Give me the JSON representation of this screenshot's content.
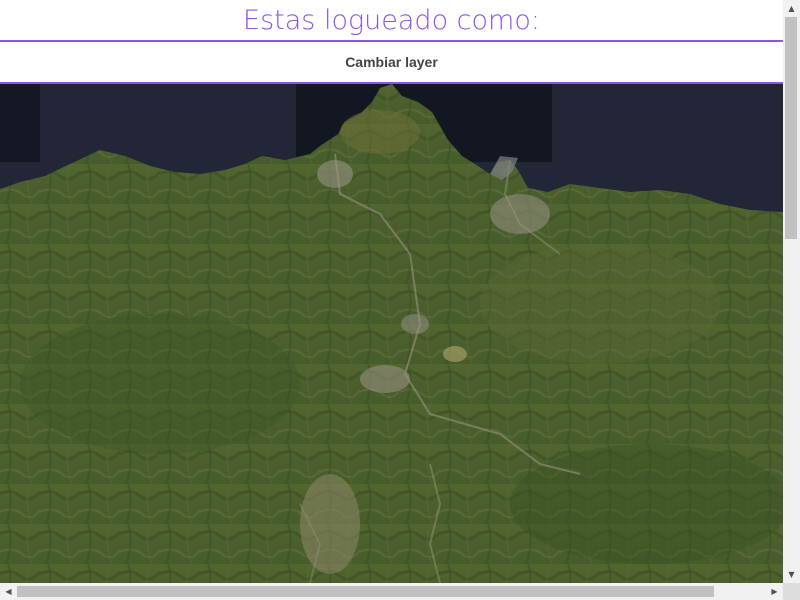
{
  "header": {
    "title": "Estas logueado como:"
  },
  "toolbar": {
    "change_layer_label": "Cambiar layer"
  },
  "map": {
    "layer": "satellite",
    "colors": {
      "sea": "#232636",
      "land_dark": "#3a5229",
      "land_mid": "#4f6433",
      "land_light": "#6b7440",
      "urban": "#8c8a78"
    }
  },
  "scrollbars": {
    "up_arrow": "▲",
    "down_arrow": "▼",
    "left_arrow": "◀",
    "right_arrow": "▶"
  },
  "colors": {
    "accent": "#8a55e0"
  }
}
